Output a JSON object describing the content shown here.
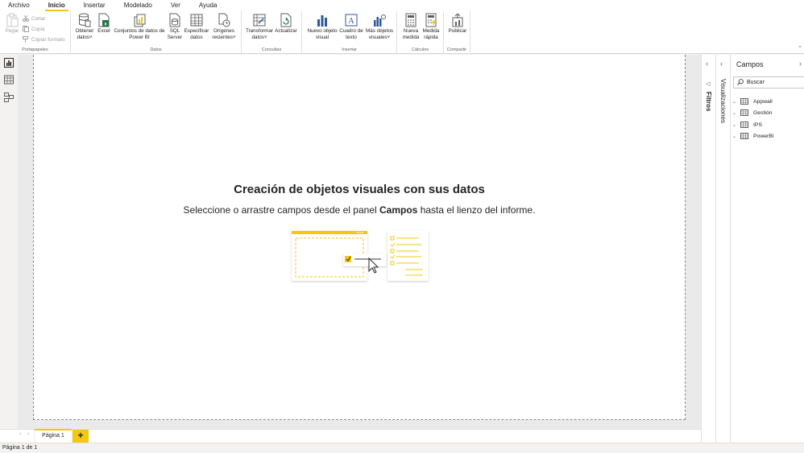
{
  "menu": {
    "tabs": [
      "Archivo",
      "Inicio",
      "Insertar",
      "Modelado",
      "Ver",
      "Ayuda"
    ],
    "active": "Inicio"
  },
  "ribbon": {
    "clipboard": {
      "paste": "Pegar",
      "cut": "Cortar",
      "copy": "Copia",
      "format_painter": "Copiar formato",
      "label": "Portapapeles"
    },
    "data": {
      "get_data": "Obtener\ndatos˅",
      "excel": "Excel",
      "datasets": "Conjuntos de datos de\nPower BI",
      "sql": "SQL\nServer",
      "enter_data": "Especificar\ndatos",
      "recent": "Orígenes\nrecientes˅",
      "label": "Datos"
    },
    "queries": {
      "transform": "Transformar\ndatos˅",
      "refresh": "Actualizar",
      "label": "Consultas"
    },
    "insert": {
      "new_visual": "Nuevo objeto\nvisual",
      "text_box": "Cuadro de\ntexto",
      "more_visuals": "Más objetos\nvisuales˅",
      "label": "Insertar"
    },
    "calculations": {
      "new_measure": "Nueva\nmedida",
      "quick_measure": "Medida\nrápida",
      "label": "Cálculos"
    },
    "share": {
      "publish": "Publicar",
      "label": "Compartir"
    }
  },
  "canvas": {
    "title": "Creación de objetos visuales con sus datos",
    "subtitle_before": "Seleccione o arrastre campos desde el panel ",
    "subtitle_bold": "Campos",
    "subtitle_after": " hasta el lienzo del informe."
  },
  "pages": {
    "tabs": [
      "Página 1"
    ],
    "add_label": "+"
  },
  "status": {
    "text": "Página 1 de 1"
  },
  "panes": {
    "filters_label": "Filtros",
    "visualizations_label": "Visualizaciones",
    "fields": {
      "title": "Campos",
      "search_placeholder": "Buscar",
      "tables": [
        "Appwall",
        "Gestión",
        "IPS",
        "PowerBI"
      ]
    }
  },
  "colors": {
    "accent": "#f2c811",
    "excel_green": "#217346",
    "icon_blue": "#2b579a"
  },
  "icons": {
    "report_view": "bar-chart-icon",
    "data_view": "table-grid-icon",
    "model_view": "model-icon"
  }
}
